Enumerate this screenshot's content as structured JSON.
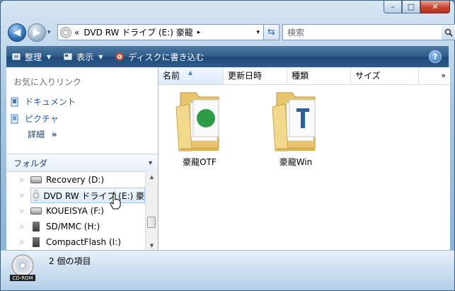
{
  "window": {
    "caption_min": "–",
    "caption_max": "□",
    "caption_close": "✕"
  },
  "nav": {
    "back_icon": "back-arrow-icon",
    "forward_icon": "forward-arrow-icon",
    "address_prefix": "«",
    "address_path": "DVD RW ドライブ (E:) 豪龍",
    "address_arrow": "▸",
    "address_dropdown": "▾",
    "search_placeholder": "検索"
  },
  "toolbar": {
    "organize_label": "整理",
    "views_label": "表示",
    "burn_label": "ディスクに書き込む",
    "help_label": "?"
  },
  "nav_pane": {
    "favorites_header": "お気に入りリンク",
    "favorites": [
      {
        "label": "ドキュメント"
      },
      {
        "label": "ピクチャ"
      }
    ],
    "more_label": "詳細",
    "more_chevron": "»",
    "folders_label": "フォルダ",
    "folders_caret": "▾",
    "tree": [
      {
        "label": "Recovery (D:)",
        "icon": "hard-drive-icon"
      },
      {
        "label": "DVD RW ドライブ (E:) 豪",
        "icon": "dvd-drive-icon",
        "selected": true
      },
      {
        "label": "KOUEISYA (F:)",
        "icon": "hard-drive-icon"
      },
      {
        "label": "SD/MMC (H:)",
        "icon": "memory-card-icon"
      },
      {
        "label": "CompactFlash (I:)",
        "icon": "memory-card-icon"
      }
    ]
  },
  "columns": {
    "name": "名前",
    "modified": "更新日時",
    "type": "種類",
    "size": "サイズ",
    "more": "»"
  },
  "files": [
    {
      "name": "豪龍OTF",
      "icon": "folder-icon"
    },
    {
      "name": "豪龍Win",
      "icon": "folder-icon"
    }
  ],
  "status": {
    "item_count": "2 個の項目",
    "icon_label": "CD-ROM"
  },
  "colors": {
    "toolbar": "#2f5c88",
    "link": "#1e5aa8",
    "folder": "#f1cf7a"
  }
}
